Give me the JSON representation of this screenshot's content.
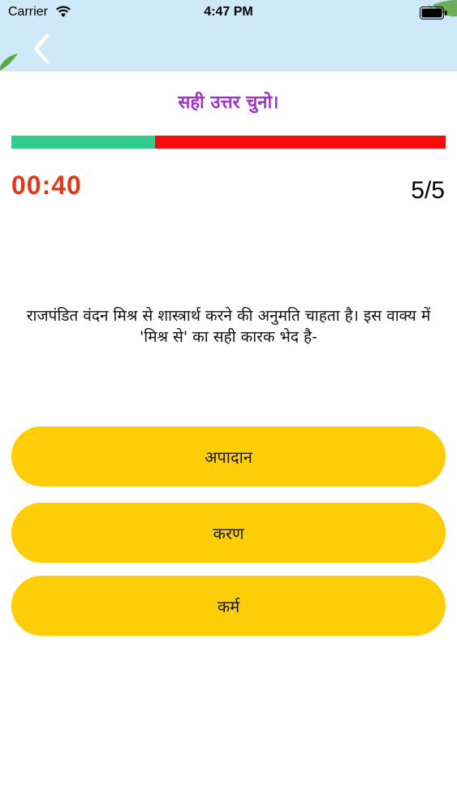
{
  "status_bar": {
    "carrier": "Carrier",
    "time": "4:47 PM"
  },
  "nav": {
    "back_icon": "chevron-left-icon"
  },
  "quiz": {
    "instruction": "सही उत्तर चुनो।",
    "progress": {
      "fraction_elapsed": 0.33,
      "colors": {
        "elapsed": "#33cc8e",
        "remaining": "#f90a0a"
      }
    },
    "timer": "00:40",
    "counter": "5/5",
    "question": "राजपंडित वंदन मिश्र से शास्त्रार्थ करने की अनुमति चाहता है। इस वाक्य में 'मिश्र से' का सही कारक भेद है-",
    "options": [
      {
        "label": "अपादान"
      },
      {
        "label": "करण"
      },
      {
        "label": "कर्म"
      }
    ]
  },
  "colors": {
    "header_bg": "#cfe9f8",
    "title": "#a033c7",
    "timer": "#e3371a",
    "option_bg": "#fdcd08"
  }
}
